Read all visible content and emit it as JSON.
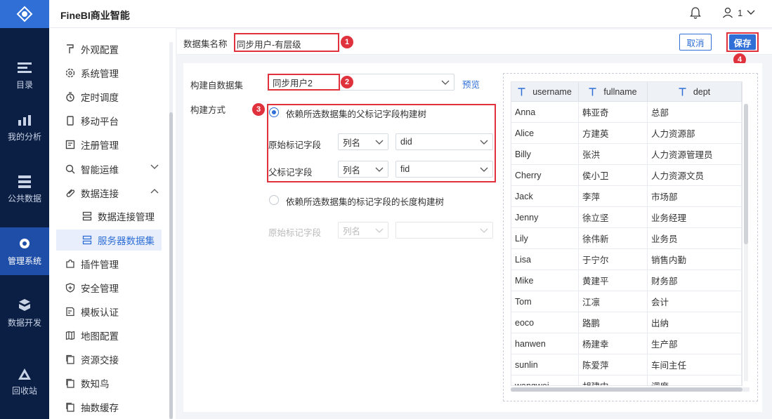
{
  "app": {
    "brand": "FineBI商业智能",
    "user": "1"
  },
  "leftnav": [
    {
      "label": "目录",
      "icon": "directory-icon"
    },
    {
      "label": "我的分析",
      "icon": "analysis-icon"
    },
    {
      "label": "公共数据",
      "icon": "public-data-icon"
    },
    {
      "label": "管理系统",
      "icon": "management-icon",
      "active": true
    },
    {
      "label": "数据开发",
      "icon": "data-dev-icon"
    },
    {
      "label": "回收站",
      "icon": "recycle-icon"
    }
  ],
  "sidebar": [
    {
      "label": "外观配置",
      "icon": "appearance-icon"
    },
    {
      "label": "系统管理",
      "icon": "gear-icon"
    },
    {
      "label": "定时调度",
      "icon": "timer-icon"
    },
    {
      "label": "移动平台",
      "icon": "mobile-icon"
    },
    {
      "label": "注册管理",
      "icon": "register-icon"
    },
    {
      "label": "智能运维",
      "icon": "ops-icon",
      "chevron": "down"
    },
    {
      "label": "数据连接",
      "icon": "link-icon",
      "chevron": "up"
    },
    {
      "label": "数据连接管理",
      "icon": "connection-icon",
      "sub": true
    },
    {
      "label": "服务器数据集",
      "icon": "server-dataset-icon",
      "sub": true,
      "selected": true
    },
    {
      "label": "插件管理",
      "icon": "plugin-icon"
    },
    {
      "label": "安全管理",
      "icon": "shield-icon"
    },
    {
      "label": "模板认证",
      "icon": "template-icon"
    },
    {
      "label": "地图配置",
      "icon": "map-icon"
    },
    {
      "label": "资源交接",
      "icon": "resource-icon"
    },
    {
      "label": "数知鸟",
      "icon": "bird-icon"
    },
    {
      "label": "抽数缓存",
      "icon": "cache-icon"
    }
  ],
  "form": {
    "dataset_name_label": "数据集名称",
    "dataset_name_value": "同步用户-有层级",
    "cancel": "取消",
    "save": "保存",
    "source_label": "构建自数据集",
    "source_value": "同步用户2",
    "preview_link": "预览",
    "method_label": "构建方式",
    "method1": "依赖所选数据集的父标记字段构建树",
    "orig_field_label": "原始标记字段",
    "parent_field_label": "父标记字段",
    "col_name": "列名",
    "orig_value": "did",
    "parent_value": "fid",
    "method2": "依赖所选数据集的标记字段的长度构建树",
    "orig_field_label2": "原始标记字段",
    "col_name2": "列名"
  },
  "badges": [
    "1",
    "2",
    "3",
    "4"
  ],
  "table": {
    "columns": [
      "username",
      "fullname",
      "dept"
    ],
    "rows": [
      [
        "Anna",
        "韩亚奇",
        "总部"
      ],
      [
        "Alice",
        "方建英",
        "人力资源部"
      ],
      [
        "Billy",
        "张洪",
        "人力资源管理员"
      ],
      [
        "Cherry",
        "侯小卫",
        "人力资源文员"
      ],
      [
        "Jack",
        "李萍",
        "市场部"
      ],
      [
        "Jenny",
        "徐立坚",
        "业务经理"
      ],
      [
        "Lily",
        "徐伟新",
        "业务员"
      ],
      [
        "Lisa",
        "于宁尔",
        "销售内勤"
      ],
      [
        "Mike",
        "黄建平",
        "财务部"
      ],
      [
        "Tom",
        "江凛",
        "会计"
      ],
      [
        "eoco",
        "路鹏",
        "出纳"
      ],
      [
        "hanwen",
        "杨建幸",
        "生产部"
      ],
      [
        "sunlin",
        "陈爱萍",
        "车间主任"
      ],
      [
        "wangwei",
        "胡建中",
        "调度"
      ]
    ]
  },
  "colors": {
    "accent": "#2f6fd6",
    "nav_bg": "#0b1f44",
    "highlight": "#e0323c"
  }
}
